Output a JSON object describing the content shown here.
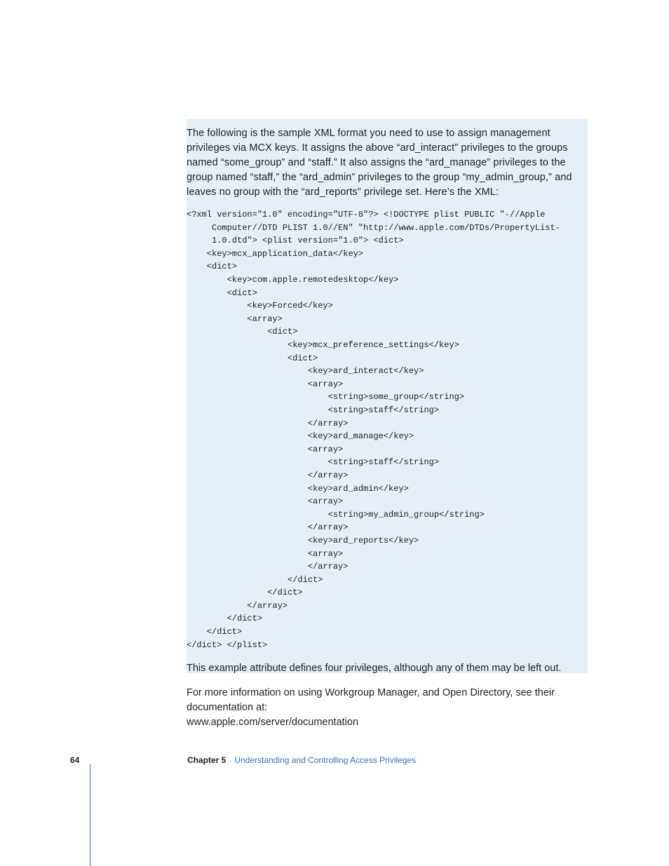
{
  "intro": "The following is the sample XML format you need to use to assign management privileges via MCX keys. It assigns the above “ard_interact” privileges to the groups named “some_group” and “staff.” It also assigns the “ard_manage” privileges to the group named “staff,” the “ard_admin” privileges to the group “my_admin_group,” and leaves no group with the “ard_reports” privilege set. Here’s the XML:",
  "code": "<?xml version=\"1.0\" encoding=\"UTF-8\"?> <!DOCTYPE plist PUBLIC \"-//Apple \n     Computer//DTD PLIST 1.0//EN\" \"http://www.apple.com/DTDs/PropertyList-\n     1.0.dtd\"> <plist version=\"1.0\"> <dict>\n    <key>mcx_application_data</key>\n    <dict>\n        <key>com.apple.remotedesktop</key>\n        <dict>\n            <key>Forced</key>\n            <array>\n                <dict>\n                    <key>mcx_preference_settings</key>\n                    <dict>\n                        <key>ard_interact</key>\n                        <array>\n                            <string>some_group</string>\n                            <string>staff</string>\n                        </array>\n                        <key>ard_manage</key>\n                        <array>\n                            <string>staff</string>\n                        </array>\n                        <key>ard_admin</key>\n                        <array>\n                            <string>my_admin_group</string>\n                        </array>\n                        <key>ard_reports</key>\n                        <array>\n                        </array>\n                    </dict>\n                </dict>\n            </array>\n        </dict>\n    </dict>\n</dict> </plist>",
  "outro": "This example attribute defines four privileges, although any of them may be left out.",
  "followup_line1": "For more information on using Workgroup Manager, and Open Directory, see their documentation at:",
  "followup_link": "www.apple.com/server/documentation",
  "footer": {
    "page": "64",
    "chapter_label": "Chapter 5",
    "chapter_title": "Understanding and Controlling Access Privileges"
  }
}
